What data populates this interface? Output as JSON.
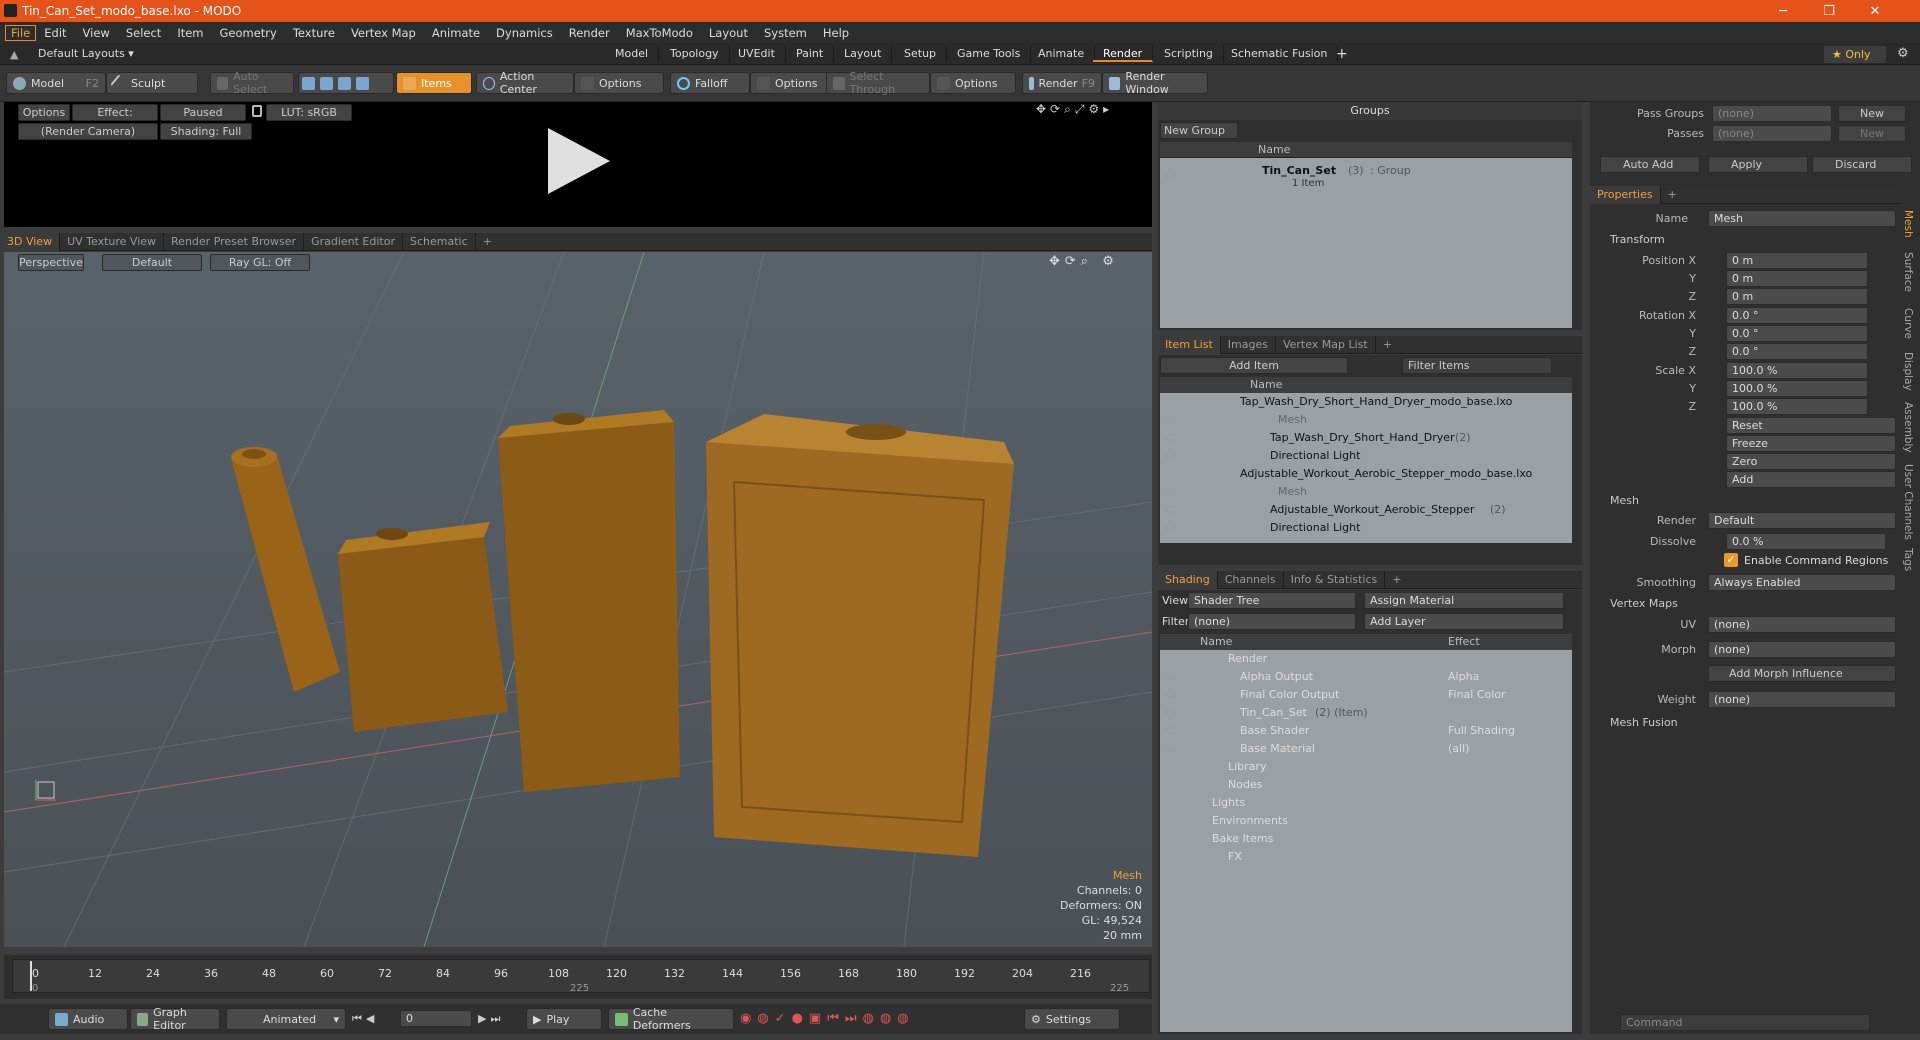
{
  "window": {
    "title": "Tin_Can_Set_modo_base.lxo - MODO"
  },
  "menu": [
    "File",
    "Edit",
    "View",
    "Select",
    "Item",
    "Geometry",
    "Texture",
    "Vertex Map",
    "Animate",
    "Dynamics",
    "Render",
    "MaxToModo",
    "Layout",
    "System",
    "Help"
  ],
  "layout": {
    "default": "Default Layouts ▾",
    "tabs": [
      "Model",
      "Topology",
      "UVEdit",
      "Paint",
      "Layout",
      "Setup",
      "Game Tools",
      "Animate",
      "Render",
      "Scripting",
      "Schematic Fusion"
    ],
    "active": "Render",
    "only": "★ Only"
  },
  "toolbar": {
    "model": "Model",
    "model_key": "F2",
    "sculpt": "Sculpt",
    "auto_select": "Auto Select",
    "items": "Items",
    "action_center": "Action Center",
    "options1": "Options",
    "falloff": "Falloff",
    "options2": "Options",
    "select_through": "Select Through",
    "options3": "Options",
    "render": "Render",
    "render_key": "F9",
    "render_window": "Render Window"
  },
  "preview": {
    "options": "Options",
    "effect": "Effect: (Shadi...",
    "paused": "Paused",
    "lut": "LUT: sRGB",
    "camera": "(Render Camera)",
    "shading": "Shading: Full"
  },
  "viewport": {
    "tabs": [
      "3D View",
      "UV Texture View",
      "Render Preset Browser",
      "Gradient Editor",
      "Schematic"
    ],
    "perspective": "Perspective",
    "default": "Default",
    "raygl": "Ray GL: Off",
    "info": {
      "item": "Mesh",
      "channels": "Channels: 0",
      "deformers": "Deformers: ON",
      "gl": "GL: 49,524",
      "scale": "20 mm"
    }
  },
  "timeline": {
    "ticks": [
      "0",
      "12",
      "24",
      "36",
      "48",
      "60",
      "72",
      "84",
      "96",
      "108",
      "120",
      "132",
      "144",
      "156",
      "168",
      "180",
      "192",
      "204",
      "216"
    ],
    "sub": [
      "0",
      "225",
      "225"
    ]
  },
  "bottombar": {
    "audio": "Audio",
    "graph_editor": "Graph Editor",
    "animated": "Animated",
    "frame": "0",
    "play": "Play",
    "cache": "Cache Deformers",
    "settings": "Settings"
  },
  "groups": {
    "title": "Groups",
    "new_group": "New Group",
    "col_name": "Name",
    "item_name": "Tin_Can_Set",
    "item_count": "(3)",
    "item_type": ": Group",
    "item_sub": "1 Item"
  },
  "itemlist": {
    "tabs": [
      "Item List",
      "Images",
      "Vertex Map List"
    ],
    "add_item": "Add Item",
    "filter": "Filter Items",
    "col_name": "Name",
    "rows": [
      {
        "t": "Tap_Wash_Dry_Short_Hand_Dryer_modo_base.lxo"
      },
      {
        "t": "Mesh"
      },
      {
        "t": "Tap_Wash_Dry_Short_Hand_Dryer",
        "c": "(2)"
      },
      {
        "t": "Directional Light"
      },
      {
        "t": "Adjustable_Workout_Aerobic_Stepper_modo_base.lxo"
      },
      {
        "t": "Mesh"
      },
      {
        "t": "Adjustable_Workout_Aerobic_Stepper",
        "c": "(2)"
      },
      {
        "t": "Directional Light"
      }
    ]
  },
  "shading": {
    "tabs": [
      "Shading",
      "Channels",
      "Info & Statistics"
    ],
    "view_label": "View",
    "view": "Shader Tree",
    "assign": "Assign Material",
    "filter_label": "Filter",
    "filter": "(none)",
    "add_layer": "Add Layer",
    "col_name": "Name",
    "col_effect": "Effect",
    "rows": [
      {
        "n": "Render",
        "e": ""
      },
      {
        "n": "Alpha Output",
        "e": "Alpha"
      },
      {
        "n": "Final Color Output",
        "e": "Final Color"
      },
      {
        "n": "Tin_Can_Set",
        "c": "(2) (Item)",
        "e": ""
      },
      {
        "n": "Base Shader",
        "e": "Full Shading"
      },
      {
        "n": "Base Material",
        "e": "(all)"
      },
      {
        "n": "Library",
        "e": ""
      },
      {
        "n": "Nodes",
        "e": ""
      },
      {
        "n": "Lights",
        "e": ""
      },
      {
        "n": "Environments",
        "e": ""
      },
      {
        "n": "Bake Items",
        "e": ""
      },
      {
        "n": "FX",
        "e": ""
      }
    ]
  },
  "props": {
    "pass_groups": "Pass Groups",
    "passes": "Passes",
    "none": "(none)",
    "new": "New",
    "auto_add": "Auto Add",
    "apply": "Apply",
    "discard": "Discard",
    "tab": "Properties",
    "name_label": "Name",
    "name": "Mesh",
    "transform": "Transform",
    "pos_label": "Position X",
    "rot_label": "Rotation X",
    "scale_label": "Scale X",
    "y": "Y",
    "z": "Z",
    "pos": [
      "0 m",
      "0 m",
      "0 m"
    ],
    "rot": [
      "0.0 °",
      "0.0 °",
      "0.0 °"
    ],
    "scale": [
      "100.0 %",
      "100.0 %",
      "100.0 %"
    ],
    "reset": "Reset",
    "freeze": "Freeze",
    "zero": "Zero",
    "add": "Add",
    "mesh": "Mesh",
    "render_label": "Render",
    "render": "Default",
    "dissolve_label": "Dissolve",
    "dissolve": "0.0 %",
    "cmd_regions": "Enable Command Regions",
    "smoothing_label": "Smoothing",
    "smoothing": "Always Enabled",
    "vertex_maps": "Vertex Maps",
    "uv_label": "UV",
    "morph_label": "Morph",
    "add_morph": "Add Morph Influence",
    "weight_label": "Weight",
    "mesh_fusion": "Mesh Fusion",
    "command": "Command",
    "vtabs": [
      "Mesh",
      "Surface",
      "Curve",
      "Display",
      "Assembly",
      "User Channels",
      "Tags"
    ]
  }
}
